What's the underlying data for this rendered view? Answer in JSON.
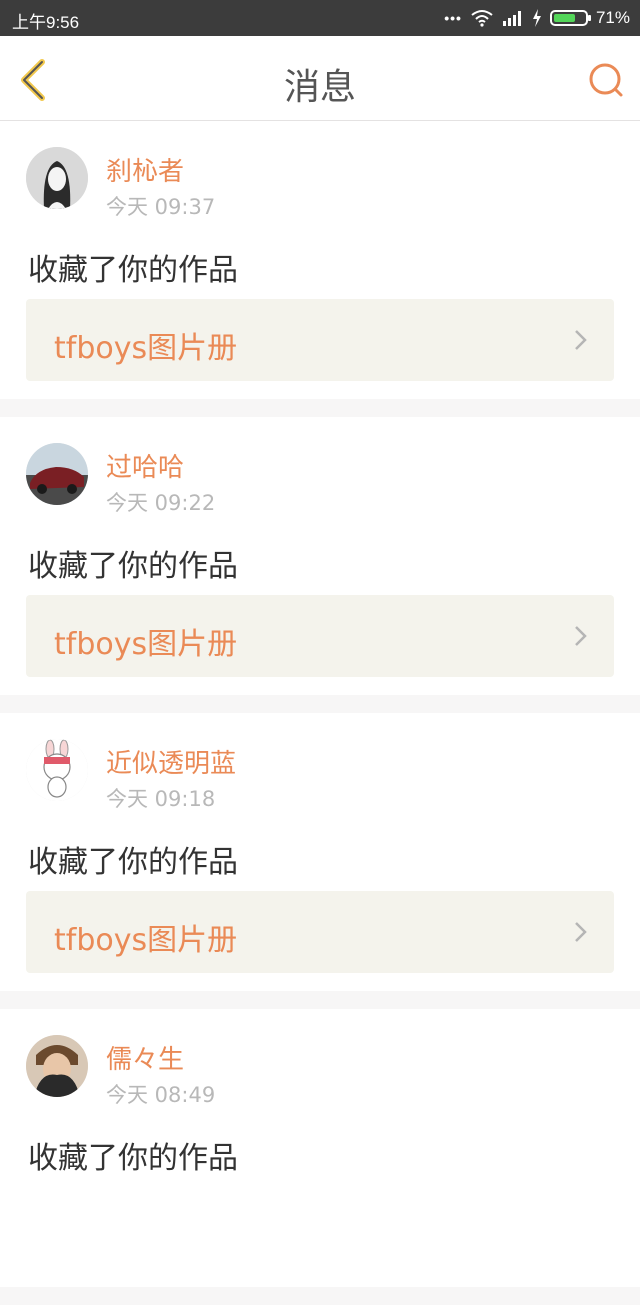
{
  "status_bar": {
    "time": "上午9:56",
    "battery": "71%",
    "battery_level": 0.71,
    "icons": [
      "more-dots-icon",
      "wifi-icon",
      "signal-icon",
      "charging-icon",
      "battery-icon"
    ]
  },
  "nav": {
    "title": "消息",
    "back_icon": "chevron-left-icon",
    "search_icon": "search-icon"
  },
  "colors": {
    "accent": "#ea8a56",
    "status_bar": "#3c3c3c",
    "card_link_bg": "#f4f3ec",
    "battery": "#53d659"
  },
  "messages": [
    {
      "user": "刹杺者",
      "time": "今天 09:37",
      "action": "收藏了你的作品",
      "work": "tfboys图片册"
    },
    {
      "user": "过哈哈",
      "time": "今天 09:22",
      "action": "收藏了你的作品",
      "work": "tfboys图片册"
    },
    {
      "user": "近似透明蓝",
      "time": "今天 09:18",
      "action": "收藏了你的作品",
      "work": "tfboys图片册"
    },
    {
      "user": "儒々生",
      "time": "今天 08:49",
      "action": "收藏了你的作品",
      "work": ""
    }
  ]
}
